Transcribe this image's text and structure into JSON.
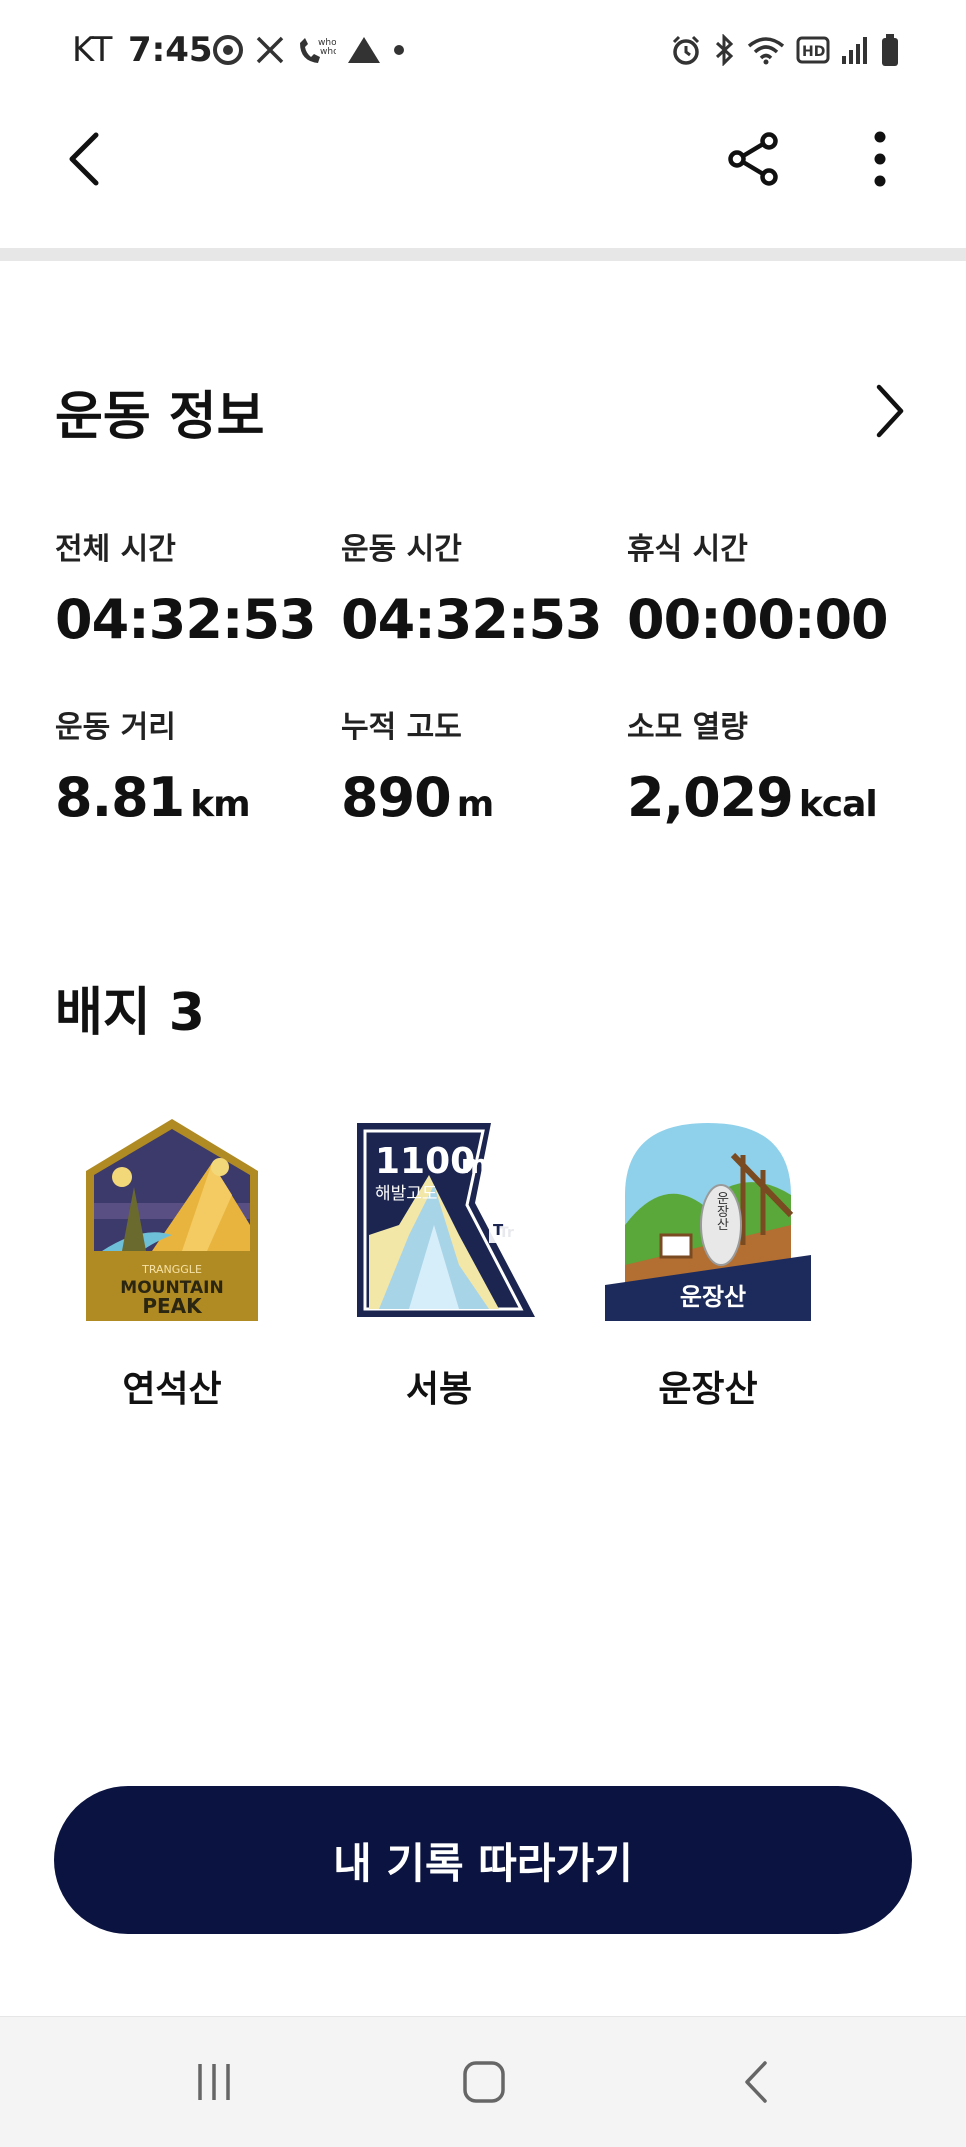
{
  "status_bar": {
    "carrier": "KT",
    "time": "7:45",
    "left_icons": [
      "chrome-icon",
      "mute-call-icon",
      "whowho-icon",
      "drive-icon",
      "dot-icon"
    ],
    "right_icons": [
      "alarm-icon",
      "bluetooth-icon",
      "wifi-icon",
      "hd-icon",
      "signal-icon",
      "battery-icon"
    ]
  },
  "top_bar": {
    "icons": [
      "back-arrow-icon",
      "share-icon",
      "more-vertical-icon"
    ]
  },
  "workout_info": {
    "title": "운동 정보",
    "stats": [
      {
        "label": "전체 시간",
        "value": "04:32:53",
        "unit": ""
      },
      {
        "label": "운동 시간",
        "value": "04:32:53",
        "unit": ""
      },
      {
        "label": "휴식 시간",
        "value": "00:00:00",
        "unit": ""
      },
      {
        "label": "운동 거리",
        "value": "8.81",
        "unit": "km"
      },
      {
        "label": "누적 고도",
        "value": "890",
        "unit": "m"
      },
      {
        "label": "소모 열량",
        "value": "2,029",
        "unit": "kcal"
      }
    ]
  },
  "badges": {
    "title": "배지 3",
    "items": [
      {
        "name": "연석산",
        "image_text": {
          "line1": "TRANGGLE",
          "line2": "MOUNTAIN",
          "line3": "PEAK"
        }
      },
      {
        "name": "서봉",
        "image_text": {
          "height": "1100",
          "unit": "m",
          "label": "해발고도",
          "logo": "Tr"
        }
      },
      {
        "name": "운장산",
        "image_text": {
          "stone": "운장산",
          "banner": "운장산"
        }
      }
    ]
  },
  "follow_button": {
    "label": "내 기록 따라가기"
  },
  "nav_bar": {
    "icons": [
      "recent-apps-icon",
      "home-icon",
      "back-icon"
    ]
  },
  "colors": {
    "primary_button": "#0b1340",
    "divider": "#e7e7e7",
    "nav_background": "#f4f4f4"
  }
}
